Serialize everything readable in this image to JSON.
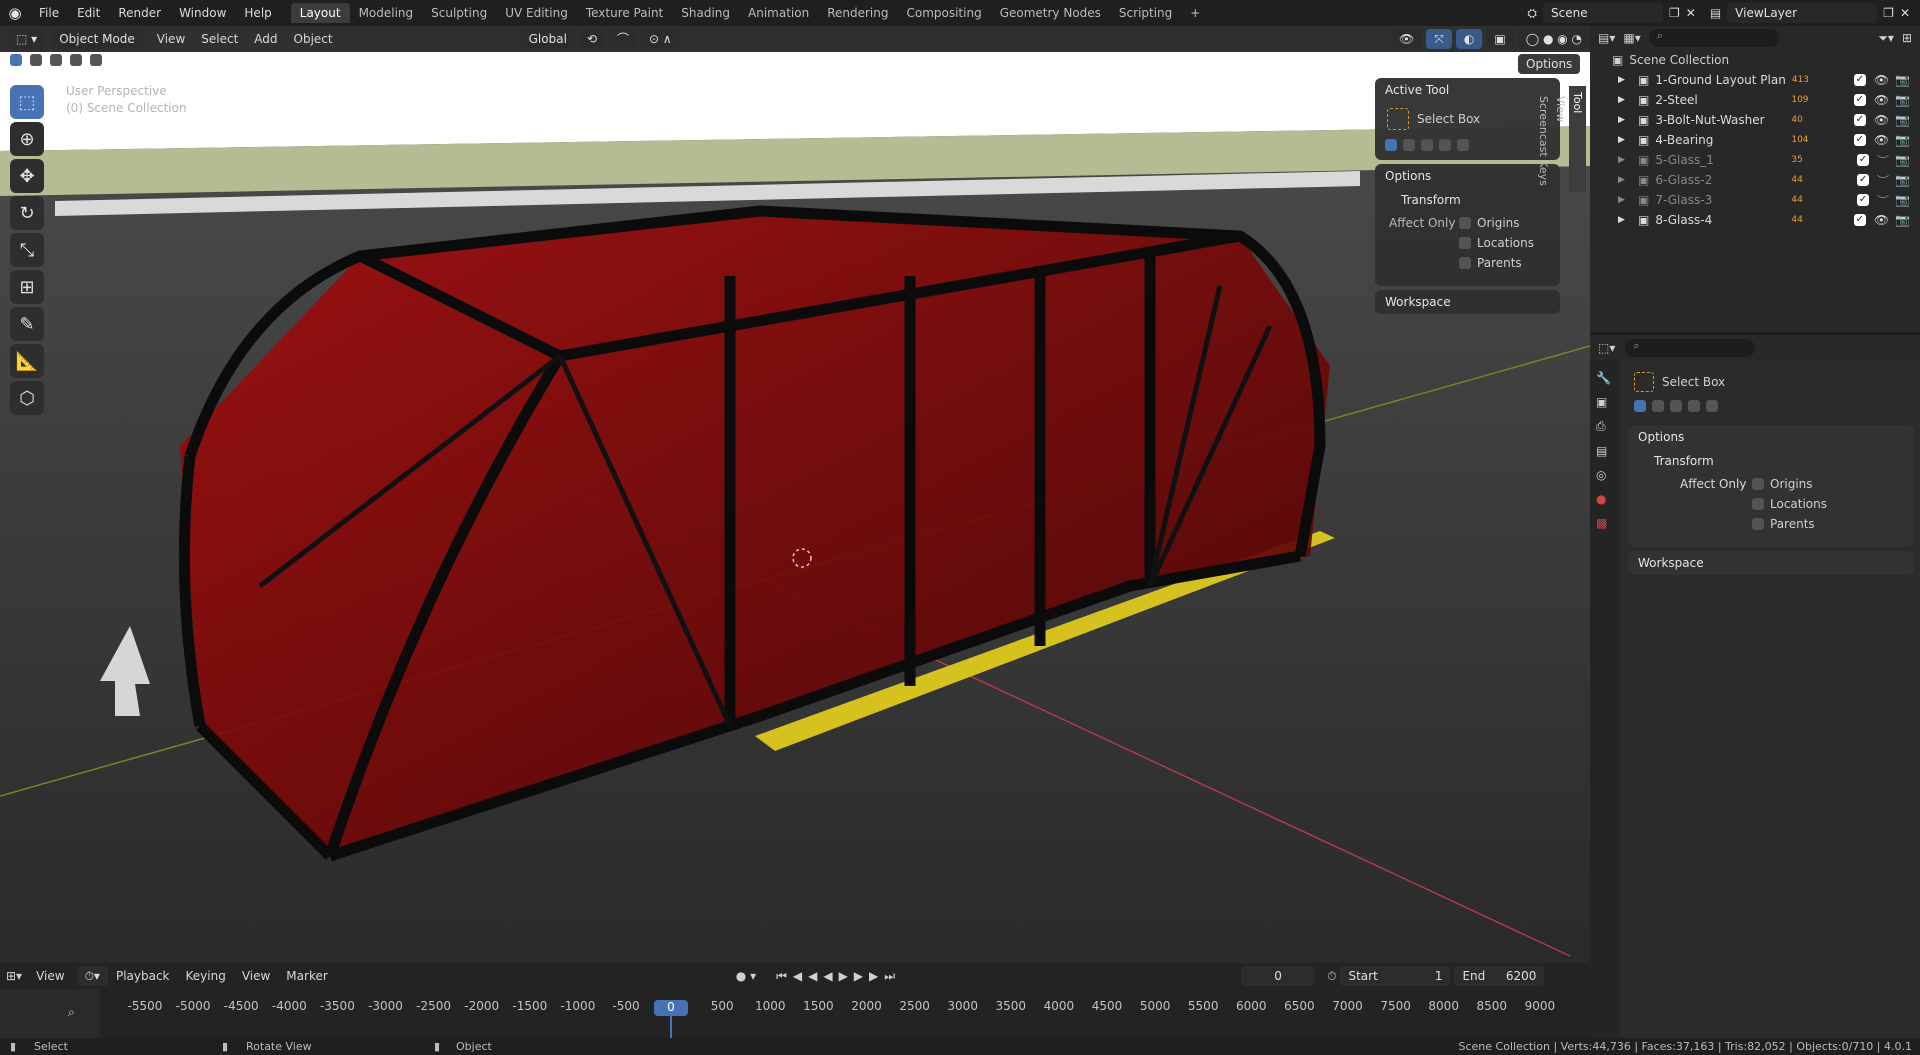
{
  "app": {
    "menu": [
      "File",
      "Edit",
      "Render",
      "Window",
      "Help"
    ],
    "workspaces": [
      "Layout",
      "Modeling",
      "Sculpting",
      "UV Editing",
      "Texture Paint",
      "Shading",
      "Animation",
      "Rendering",
      "Compositing",
      "Geometry Nodes",
      "Scripting"
    ],
    "active_workspace": "Layout",
    "add_tab": "+",
    "scene": "Scene",
    "view_layer": "ViewLayer"
  },
  "viewport": {
    "mode": "Object Mode",
    "menus": [
      "View",
      "Select",
      "Add",
      "Object"
    ],
    "orientation": "Global",
    "options_btn": "Options",
    "overlay_title": "User Perspective",
    "overlay_sub": "(0) Scene Collection"
  },
  "npanel": {
    "tabs": [
      "Tool",
      "View",
      "Screencast Keys"
    ],
    "active_tool_header": "Active Tool",
    "tool_name": "Select Box",
    "options_header": "Options",
    "transform_header": "Transform",
    "affect_only": "Affect Only",
    "checks": [
      "Origins",
      "Locations",
      "Parents"
    ],
    "workspace_header": "Workspace"
  },
  "outliner": {
    "root": "Scene Collection",
    "items": [
      {
        "name": "1-Ground Layout Plan",
        "badge": "413",
        "dim": false
      },
      {
        "name": "2-Steel",
        "badge": "109",
        "dim": false
      },
      {
        "name": "3-Bolt-Nut-Washer",
        "badge": "40",
        "dim": false
      },
      {
        "name": "4-Bearing",
        "badge": "104",
        "dim": false
      },
      {
        "name": "5-Glass_1",
        "badge": "35",
        "dim": true
      },
      {
        "name": "6-Glass-2",
        "badge": "44",
        "dim": true
      },
      {
        "name": "7-Glass-3",
        "badge": "44",
        "dim": true
      },
      {
        "name": "8-Glass-4",
        "badge": "44",
        "dim": false
      }
    ]
  },
  "properties": {
    "tool_name": "Select Box",
    "options_header": "Options",
    "transform_header": "Transform",
    "affect_only": "Affect Only",
    "checks": [
      "Origins",
      "Locations",
      "Parents"
    ],
    "workspace_header": "Workspace"
  },
  "timeline": {
    "menus": [
      "View",
      "Playback",
      "Keying",
      "View",
      "Marker"
    ],
    "frame": "0",
    "start_label": "Start",
    "start": "1",
    "end_label": "End",
    "end": "6200",
    "current_frame": "0",
    "ticks": [
      "-5500",
      "-5000",
      "-4500",
      "-4000",
      "-3500",
      "-3000",
      "-2500",
      "-2000",
      "-1500",
      "-1000",
      "-500",
      "0",
      "500",
      "1000",
      "1500",
      "2000",
      "2500",
      "3000",
      "3500",
      "4000",
      "4500",
      "5000",
      "5500",
      "6000",
      "6500",
      "7000",
      "7500",
      "8000",
      "8500",
      "9000"
    ]
  },
  "status": {
    "select": "Select",
    "rotate": "Rotate View",
    "object": "Object",
    "stats": "Scene Collection | Verts:44,736 | Faces:37,163 | Tris:82,052 | Objects:0/710 | 4.0.1"
  },
  "colors": {
    "accent": "#4772b3",
    "glass": "#8a0a0a",
    "ground": "#3a3a3a",
    "line": "#d6c21e"
  }
}
